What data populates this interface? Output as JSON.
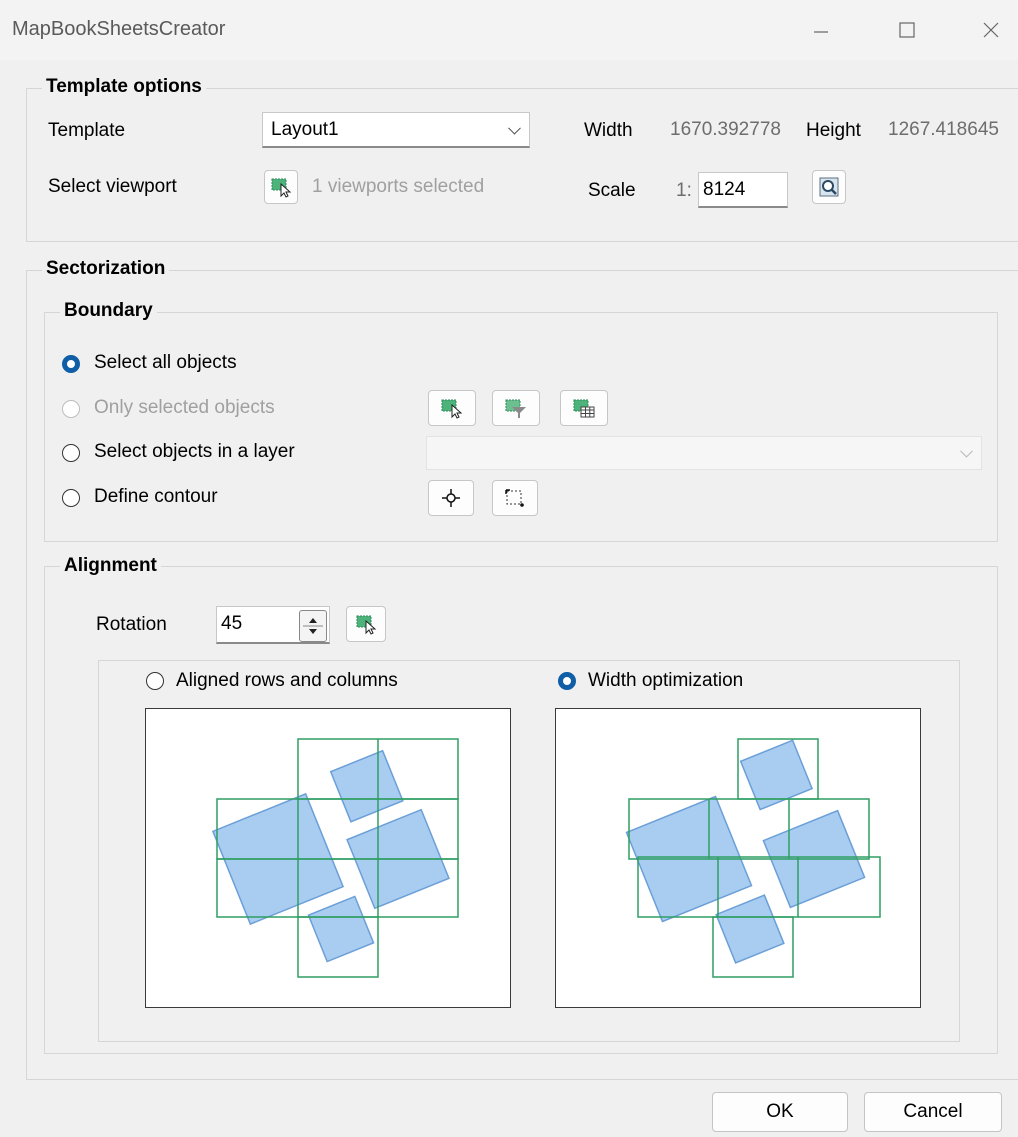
{
  "window": {
    "title": "MapBookSheetsCreator",
    "controls": [
      "minimize-icon",
      "maximize-icon",
      "close-icon"
    ]
  },
  "template_options": {
    "legend": "Template options",
    "template_label": "Template",
    "template_value": "Layout1",
    "width_label": "Width",
    "width_value": "1670.392778",
    "height_label": "Height",
    "height_value": "1267.418645",
    "viewport_label": "Select viewport",
    "viewport_status": "1 viewports selected",
    "scale_label": "Scale",
    "scale_prefix": "1:",
    "scale_value": "8124"
  },
  "sectorization": {
    "legend": "Sectorization",
    "boundary": {
      "legend": "Boundary",
      "options": [
        {
          "label": "Select all objects",
          "checked": true,
          "enabled": true
        },
        {
          "label": "Only selected objects",
          "checked": false,
          "enabled": false
        },
        {
          "label": "Select objects in a layer",
          "checked": false,
          "enabled": true
        },
        {
          "label": "Define contour",
          "checked": false,
          "enabled": true
        }
      ],
      "layer_value": ""
    },
    "alignment": {
      "legend": "Alignment",
      "rotation_label": "Rotation",
      "rotation_value": "45",
      "modes": [
        {
          "label": "Aligned rows and columns",
          "checked": false
        },
        {
          "label": "Width optimization",
          "checked": true
        }
      ]
    }
  },
  "buttons": {
    "ok": "OK",
    "cancel": "Cancel"
  },
  "colors": {
    "accent": "#0f5ea6",
    "sheet_outline": "#2e9e63",
    "object_fill": "#a9cdf0",
    "object_stroke": "#6b9fd8"
  }
}
